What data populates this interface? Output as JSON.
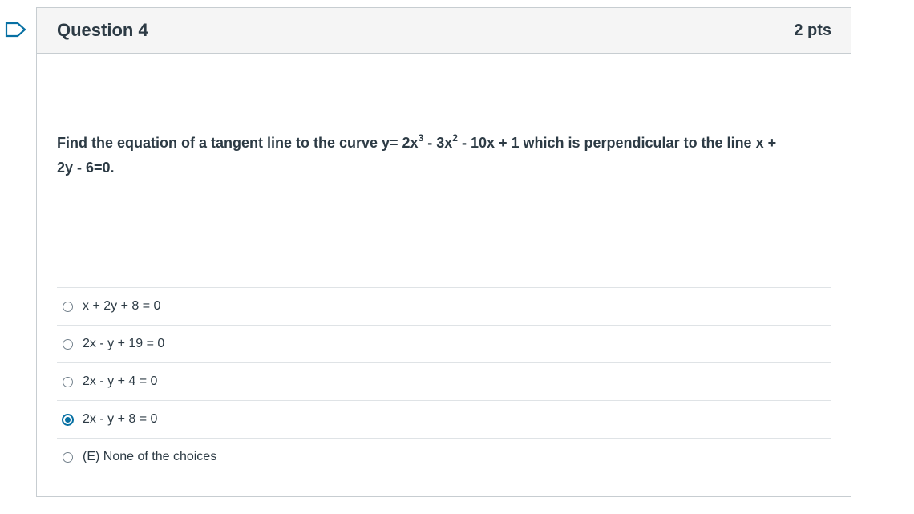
{
  "question": {
    "title": "Question 4",
    "points": "2 pts",
    "text_line1_a": "Find the equation of a tangent line to the curve y= 2x",
    "exp1": "3",
    "text_line1_b": " - 3x",
    "exp2": "2",
    "text_line1_c": " - 10x + 1 which is perpendicular to the line x +",
    "text_line2": "2y - 6=0."
  },
  "answers": [
    {
      "label": "x + 2y + 8 = 0",
      "selected": false
    },
    {
      "label": "2x - y + 19 = 0",
      "selected": false
    },
    {
      "label": "2x - y + 4 = 0",
      "selected": false
    },
    {
      "label": "2x - y + 8 = 0",
      "selected": true
    },
    {
      "label": "(E) None of the choices",
      "selected": false
    }
  ],
  "colors": {
    "accent": "#0770a3",
    "text": "#2d3b45",
    "header_bg": "#f5f5f5",
    "border": "#c7cdd1"
  },
  "icons": {
    "flag": "bookmark-flag-icon"
  }
}
